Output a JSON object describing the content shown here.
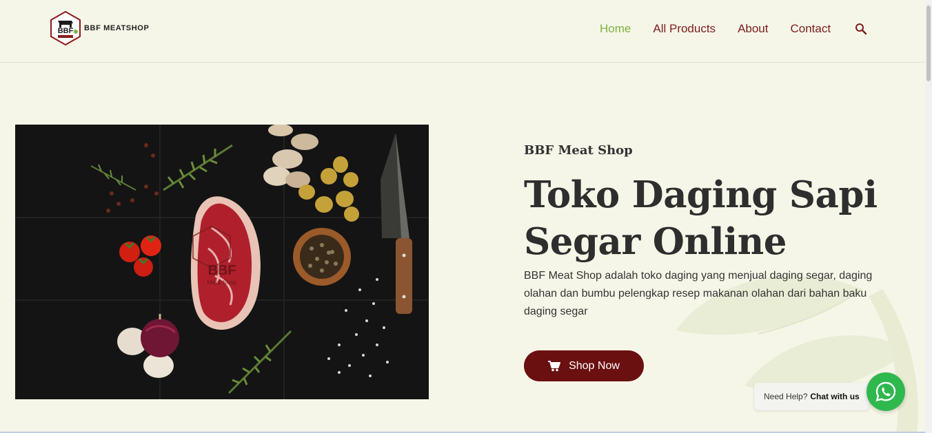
{
  "header": {
    "logo_text": "BBF MEATSHOP",
    "logo_badge_text": "BBF",
    "nav": [
      {
        "label": "Home",
        "active": true
      },
      {
        "label": "All Products",
        "active": false
      },
      {
        "label": "About",
        "active": false
      },
      {
        "label": "Contact",
        "active": false
      }
    ],
    "search_icon": "search-icon"
  },
  "hero": {
    "eyebrow": "BBF Meat Shop",
    "title": "Toko Daging Sapi Segar Online",
    "description": "BBF Meat Shop adalah toko daging yang menjual daging segar, daging olahan dan bumbu pelengkap resep makanan olahan dari bahan baku daging segar",
    "cta_label": "Shop Now",
    "cta_icon": "cart-icon",
    "image_watermark_title": "BBF",
    "image_watermark_sub": "Meat Shop"
  },
  "chat": {
    "prefix": "Need Help?",
    "action": "Chat with us",
    "icon": "whatsapp-icon"
  },
  "colors": {
    "background": "#f6f6e8",
    "brand": "#6b1010",
    "nav_text": "#7a1c1c",
    "nav_active": "#7cb342",
    "whatsapp": "#2fb84e"
  }
}
